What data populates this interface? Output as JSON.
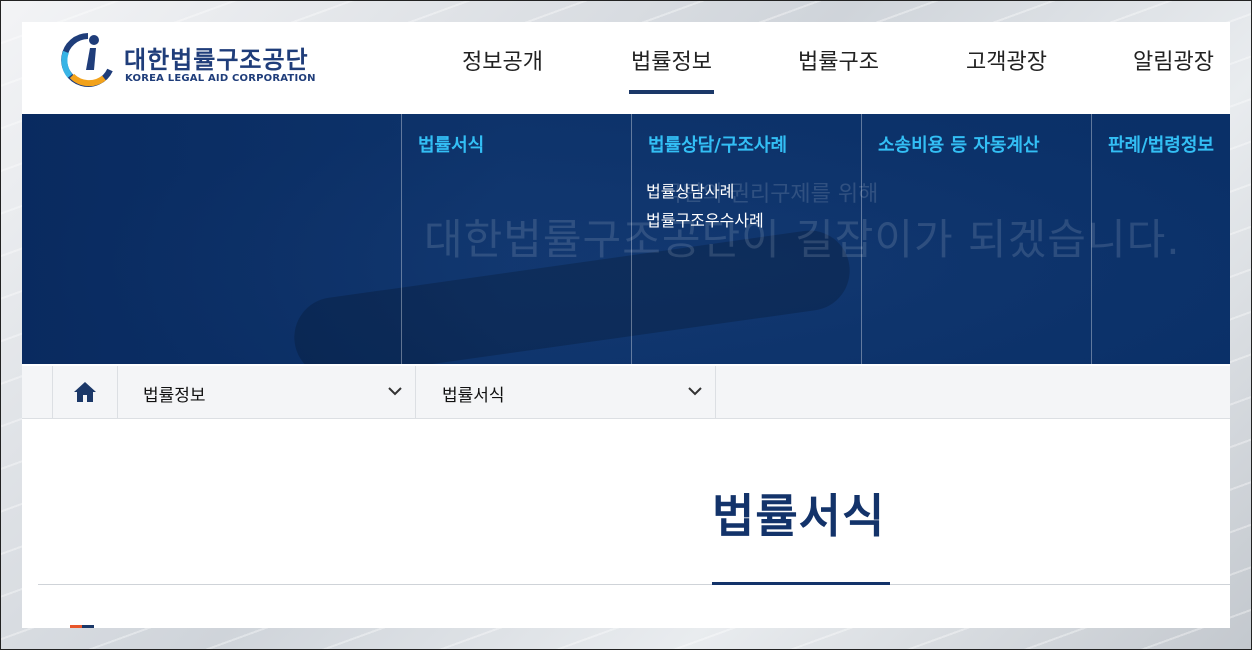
{
  "logo": {
    "name": "대한법률구조공단",
    "sub": "KOREA LEGAL AID CORPORATION"
  },
  "gnb": [
    {
      "label": "정보공개",
      "active": false
    },
    {
      "label": "법률정보",
      "active": true
    },
    {
      "label": "법률구조",
      "active": false
    },
    {
      "label": "고객광장",
      "active": false
    },
    {
      "label": "알림광장",
      "active": false
    }
  ],
  "mega": {
    "bg_text_1": "국민의 권리구제를 위해",
    "bg_text_2": "대한법률구조공단이 길잡이가 되겠습니다.",
    "columns": [
      {
        "head": "법률서식",
        "items": []
      },
      {
        "head": "법률상담/구조사례",
        "items": [
          "법률상담사례",
          "법률구조우수사례"
        ]
      },
      {
        "head": "소송비용 등 자동계산",
        "items": []
      },
      {
        "head": "판례/법령정보",
        "items": []
      }
    ]
  },
  "breadcrumb": {
    "home_icon": "home-icon",
    "level1": "법률정보",
    "level2": "법률서식"
  },
  "page_title": "법률서식",
  "colors": {
    "navy": "#13336a",
    "mega_head": "#33bff5",
    "accent_orange": "#e8562a"
  }
}
